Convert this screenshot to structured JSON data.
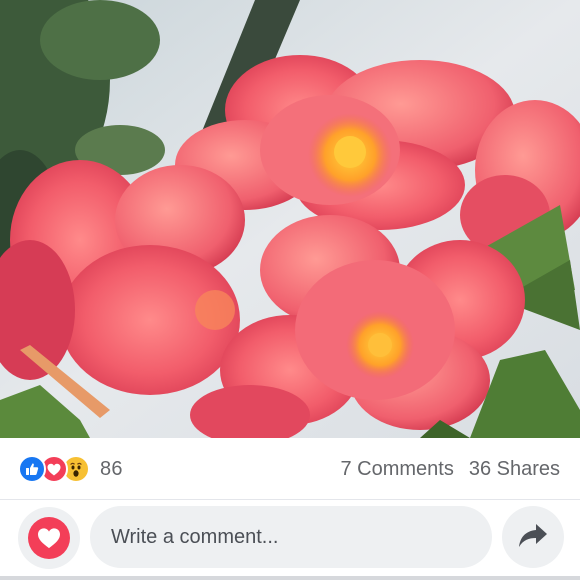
{
  "photo": {
    "subject": "pink-begonia-flowers"
  },
  "reactions": {
    "icons": [
      "like-icon",
      "love-icon",
      "wow-icon"
    ],
    "count": "86"
  },
  "stats": {
    "comments": "7 Comments",
    "shares": "36 Shares"
  },
  "composer": {
    "placeholder": "Write a comment...",
    "love_icon": "heart-icon",
    "share_icon": "share-arrow-icon"
  },
  "colors": {
    "like": "#1877f2",
    "love": "#f33e58",
    "wow": "#f7c033",
    "muted_text": "#65676b",
    "input_bg": "#eef0f2"
  }
}
